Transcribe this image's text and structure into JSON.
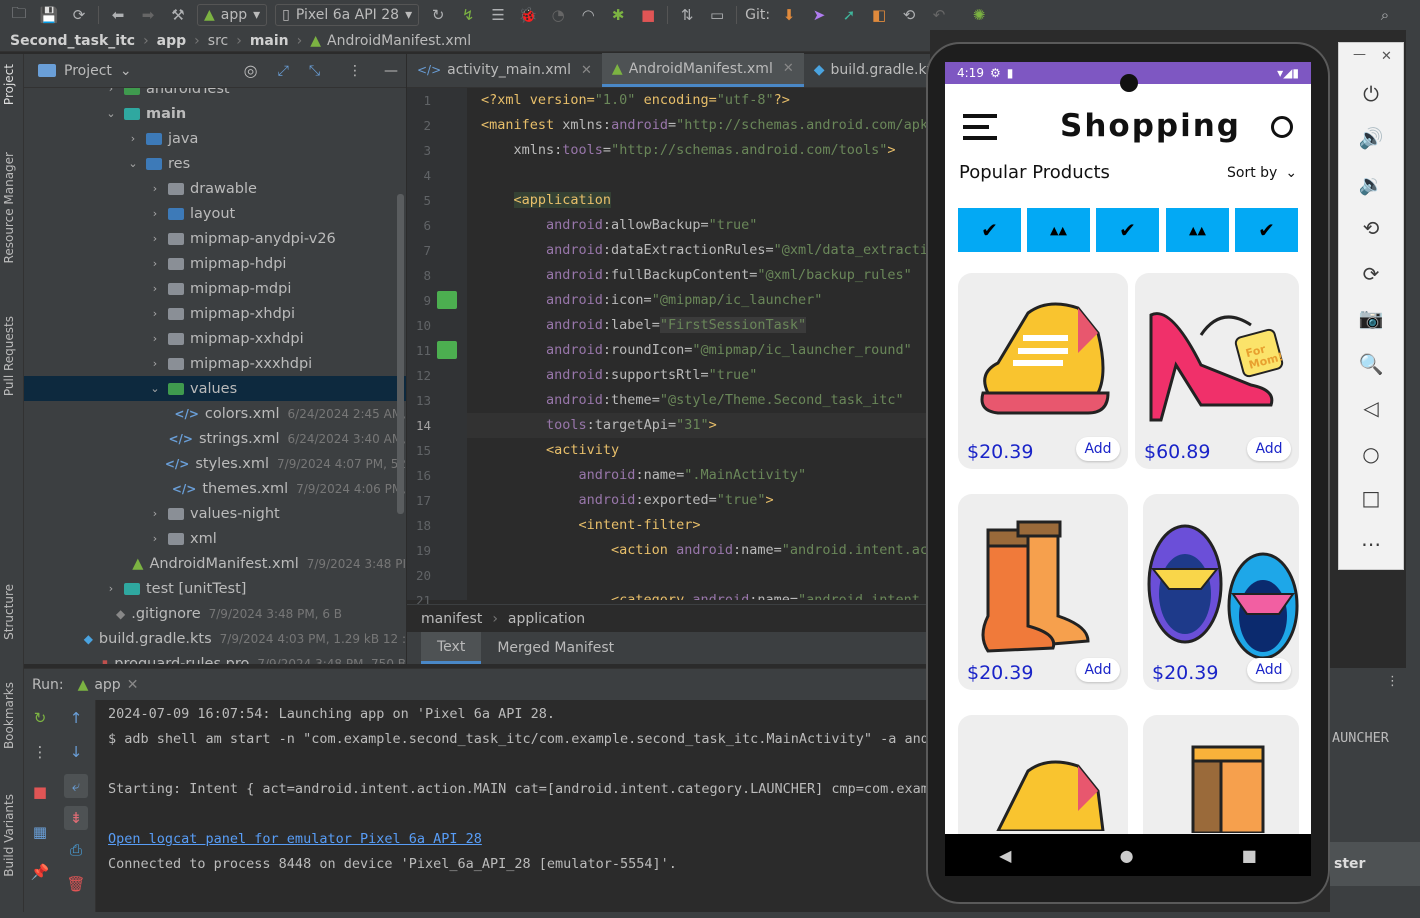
{
  "toolbar": {
    "run_config": "app",
    "device": "Pixel 6a API 28",
    "git_label": "Git:"
  },
  "breadcrumb": [
    "Second_task_itc",
    "app",
    "src",
    "main",
    "AndroidManifest.xml"
  ],
  "left_strip": [
    "Project",
    "Resource Manager",
    "Pull Requests",
    "Structure",
    "Bookmarks",
    "Build Variants"
  ],
  "project_panel": {
    "title": "Project",
    "tree": [
      {
        "label": "androidTest",
        "type": "folder-green",
        "indent": 1,
        "arrow": ">"
      },
      {
        "label": "main",
        "type": "folder-teal",
        "indent": 1,
        "arrow": "v",
        "bold": true
      },
      {
        "label": "java",
        "type": "folder-blue",
        "indent": 2,
        "arrow": ">"
      },
      {
        "label": "res",
        "type": "folder-blue",
        "indent": 2,
        "arrow": "v"
      },
      {
        "label": "drawable",
        "type": "folder",
        "indent": 3,
        "arrow": ">"
      },
      {
        "label": "layout",
        "type": "folder-blue",
        "indent": 3,
        "arrow": ">"
      },
      {
        "label": "mipmap-anydpi-v26",
        "type": "folder",
        "indent": 3,
        "arrow": ">"
      },
      {
        "label": "mipmap-hdpi",
        "type": "folder",
        "indent": 3,
        "arrow": ">"
      },
      {
        "label": "mipmap-mdpi",
        "type": "folder",
        "indent": 3,
        "arrow": ">"
      },
      {
        "label": "mipmap-xhdpi",
        "type": "folder",
        "indent": 3,
        "arrow": ">"
      },
      {
        "label": "mipmap-xxhdpi",
        "type": "folder",
        "indent": 3,
        "arrow": ">"
      },
      {
        "label": "mipmap-xxxhdpi",
        "type": "folder",
        "indent": 3,
        "arrow": ">"
      },
      {
        "label": "values",
        "type": "folder-green",
        "indent": 3,
        "arrow": "v",
        "selected": true
      },
      {
        "label": "colors.xml",
        "type": "xml",
        "indent": 4,
        "meta": "6/24/2024 2:45 AM,"
      },
      {
        "label": "strings.xml",
        "type": "xml",
        "indent": 4,
        "meta": "6/24/2024 3:40 AM,"
      },
      {
        "label": "styles.xml",
        "type": "xml",
        "indent": 4,
        "meta": "7/9/2024 4:07 PM, 52"
      },
      {
        "label": "themes.xml",
        "type": "xml",
        "indent": 4,
        "meta": "7/9/2024 4:06 PM,"
      },
      {
        "label": "values-night",
        "type": "folder",
        "indent": 3,
        "arrow": ">"
      },
      {
        "label": "xml",
        "type": "folder",
        "indent": 3,
        "arrow": ">"
      },
      {
        "label": "AndroidManifest.xml",
        "type": "android",
        "indent": 2,
        "meta": "7/9/2024 3:48 PI"
      },
      {
        "label": "test [unitTest]",
        "type": "folder-teal",
        "indent": 1,
        "arrow": ">"
      },
      {
        "label": ".gitignore",
        "type": "git",
        "indent": 0,
        "meta": "7/9/2024 3:48 PM, 6 B"
      },
      {
        "label": "build.gradle.kts",
        "type": "gradle",
        "indent": 0,
        "meta": "7/9/2024 4:03 PM, 1.29 kB 12 :"
      },
      {
        "label": "proguard-rules.pro",
        "type": "pro",
        "indent": 0,
        "meta": "7/9/2024 3:48 PM, 750 B"
      }
    ]
  },
  "editor": {
    "tabs": [
      {
        "label": "activity_main.xml",
        "active": false
      },
      {
        "label": "AndroidManifest.xml",
        "active": true
      },
      {
        "label": "build.gradle.kts",
        "active": false
      }
    ],
    "line_numbers": [
      "1",
      "2",
      "3",
      "4",
      "5",
      "6",
      "7",
      "8",
      "9",
      "10",
      "11",
      "12",
      "13",
      "14",
      "15",
      "16",
      "17",
      "18",
      "19",
      "20",
      "21"
    ],
    "code_lines": [
      [
        [
          "pi",
          "<?xml version="
        ],
        [
          "val",
          "\"1.0\""
        ],
        [
          "pi",
          " encoding="
        ],
        [
          "val",
          "\"utf-8\""
        ],
        [
          "pi",
          "?>"
        ]
      ],
      [
        [
          "tag",
          "<manifest "
        ],
        [
          "attr",
          "xmlns:"
        ],
        [
          "ns",
          "android"
        ],
        [
          "attr",
          "="
        ],
        [
          "val",
          "\"http://schemas.android.com/apk/"
        ]
      ],
      [
        [
          "attr",
          "    xmlns:"
        ],
        [
          "ns",
          "tools"
        ],
        [
          "attr",
          "="
        ],
        [
          "val",
          "\"http://schemas.android.com/tools\""
        ],
        [
          "tag",
          ">"
        ]
      ],
      [
        [
          "plain",
          ""
        ]
      ],
      [
        [
          "plain",
          "    "
        ],
        [
          "taghl",
          "<application"
        ]
      ],
      [
        [
          "ns",
          "        android"
        ],
        [
          "attr",
          ":allowBackup="
        ],
        [
          "val",
          "\"true\""
        ]
      ],
      [
        [
          "ns",
          "        android"
        ],
        [
          "attr",
          ":dataExtractionRules="
        ],
        [
          "val",
          "\"@xml/data_extractio"
        ]
      ],
      [
        [
          "ns",
          "        android"
        ],
        [
          "attr",
          ":fullBackupContent="
        ],
        [
          "val",
          "\"@xml/backup_rules\""
        ]
      ],
      [
        [
          "ns",
          "        android"
        ],
        [
          "attr",
          ":icon="
        ],
        [
          "val",
          "\"@mipmap/ic_launcher\""
        ]
      ],
      [
        [
          "ns",
          "        android"
        ],
        [
          "attr",
          ":label="
        ],
        [
          "valhl",
          "\"FirstSessionTask\""
        ]
      ],
      [
        [
          "ns",
          "        android"
        ],
        [
          "attr",
          ":roundIcon="
        ],
        [
          "val",
          "\"@mipmap/ic_launcher_round\""
        ]
      ],
      [
        [
          "ns",
          "        android"
        ],
        [
          "attr",
          ":supportsRtl="
        ],
        [
          "val",
          "\"true\""
        ]
      ],
      [
        [
          "ns",
          "        android"
        ],
        [
          "attr",
          ":theme="
        ],
        [
          "val",
          "\"@style/Theme.Second_task_itc\""
        ]
      ],
      [
        [
          "ns",
          "        tools"
        ],
        [
          "attr",
          ":targetApi="
        ],
        [
          "val",
          "\"31\""
        ],
        [
          "tag",
          ">"
        ]
      ],
      [
        [
          "tag",
          "        <activity"
        ]
      ],
      [
        [
          "ns",
          "            android"
        ],
        [
          "attr",
          ":name="
        ],
        [
          "val",
          "\".MainActivity\""
        ]
      ],
      [
        [
          "ns",
          "            android"
        ],
        [
          "attr",
          ":exported="
        ],
        [
          "val",
          "\"true\""
        ],
        [
          "tag",
          ">"
        ]
      ],
      [
        [
          "tag",
          "            <intent-filter>"
        ]
      ],
      [
        [
          "tag",
          "                <action "
        ],
        [
          "ns",
          "android"
        ],
        [
          "attr",
          ":name="
        ],
        [
          "val",
          "\"android.intent.act"
        ]
      ],
      [
        [
          "plain",
          ""
        ]
      ],
      [
        [
          "tag",
          "                <category "
        ],
        [
          "ns",
          "android"
        ],
        [
          "attr",
          ":name="
        ],
        [
          "val",
          "\"android.intent.c"
        ]
      ]
    ],
    "breadcrumb": [
      "manifest",
      "application"
    ],
    "bottom_tabs": [
      {
        "label": "Text",
        "active": true
      },
      {
        "label": "Merged Manifest",
        "active": false
      }
    ]
  },
  "run_panel": {
    "label": "Run:",
    "tab": "app",
    "lines": [
      "2024-07-09 16:07:54: Launching app on 'Pixel 6a API 28.",
      "$ adb shell am start -n \"com.example.second_task_itc/com.example.second_task_itc.MainActivity\" -a andr",
      "",
      "Starting: Intent { act=android.intent.action.MAIN cat=[android.intent.category.LAUNCHER] cmp=com.examp",
      "",
      "Open logcat panel for emulator Pixel 6a API 28",
      "Connected to process 8448 on device 'Pixel_6a_API_28 [emulator-5554]'."
    ],
    "right_fragment": "AUNCHER",
    "right_bottom": "ster"
  },
  "emulator": {
    "time": "4:19",
    "app_title": "Shopping",
    "section_title": "Popular Products",
    "sort_label": "Sort by",
    "products": [
      {
        "price": "$20.39",
        "add": "Add",
        "kind": "sneaker"
      },
      {
        "price": "$60.89",
        "add": "Add",
        "kind": "heel",
        "tag": "For Mom!"
      },
      {
        "price": "$20.39",
        "add": "Add",
        "kind": "boots"
      },
      {
        "price": "$20.39",
        "add": "Add",
        "kind": "baby-shoes"
      }
    ],
    "brands": [
      "nike",
      "adidas",
      "nike",
      "adidas",
      "nike"
    ],
    "colors": {
      "status_bar": "#7e57c2",
      "brand_bg": "#03a9f4",
      "price": "#1a24c8",
      "card_bg": "#eeeeee"
    }
  }
}
